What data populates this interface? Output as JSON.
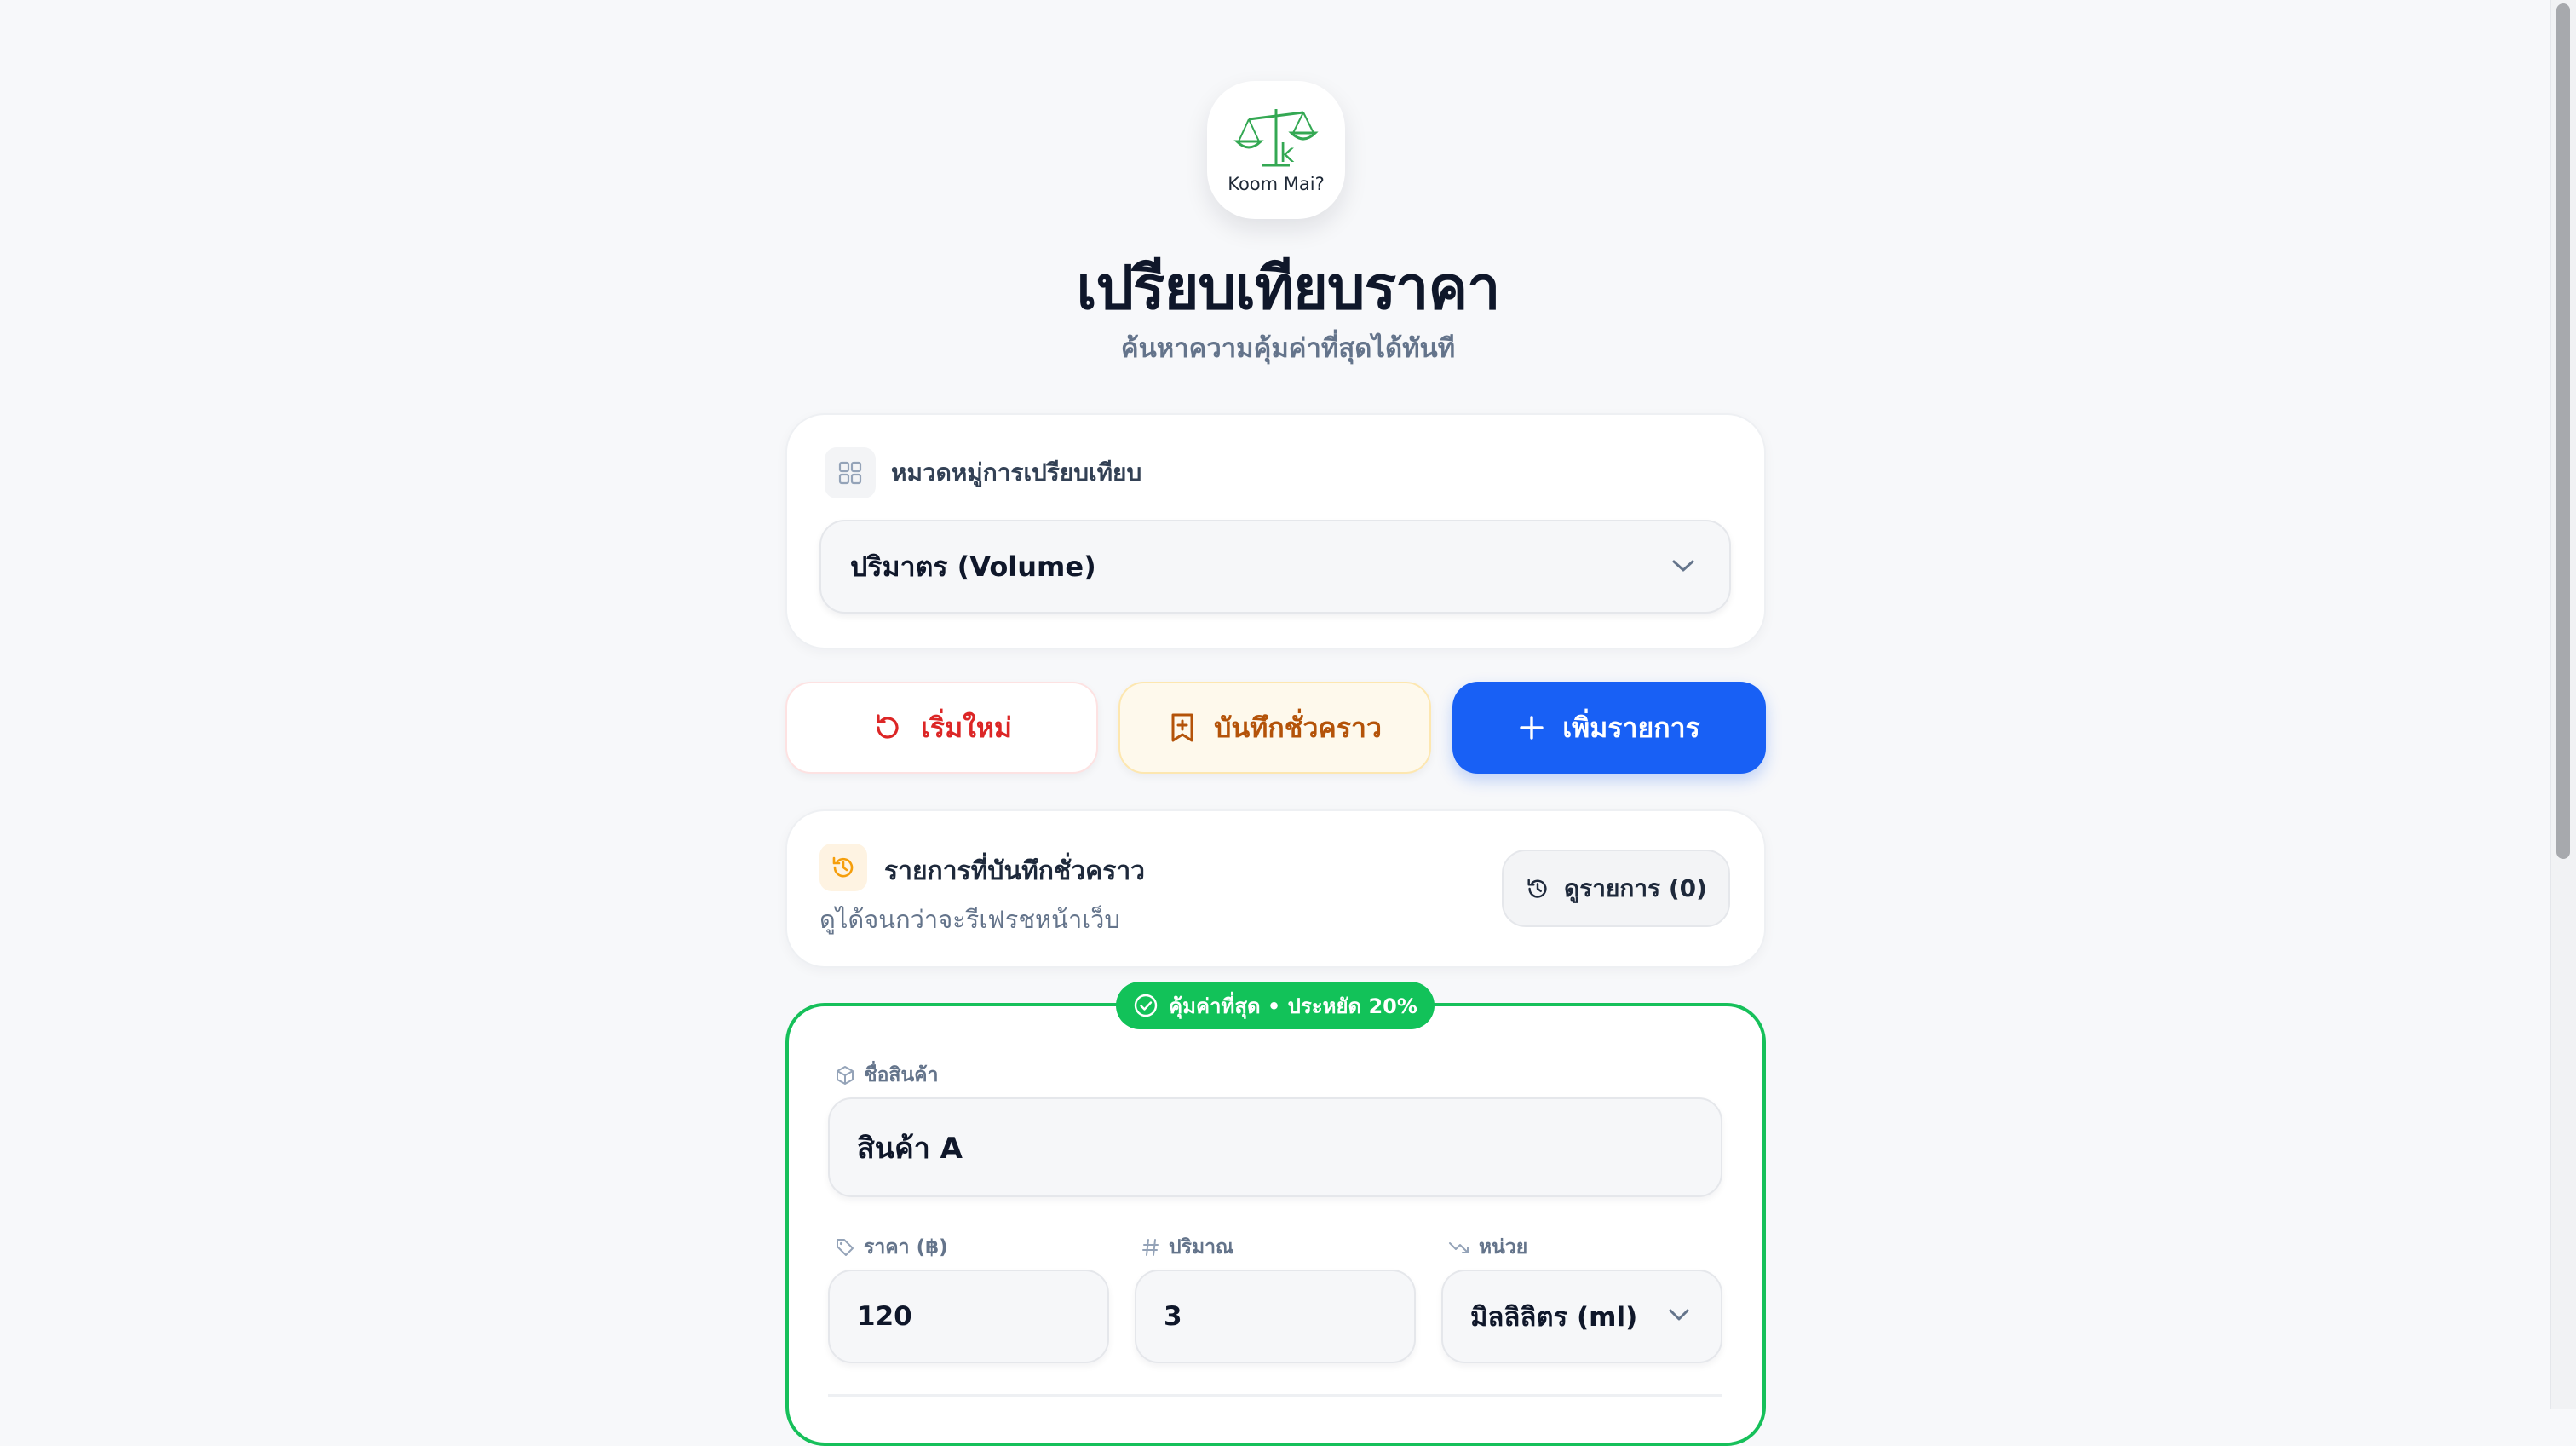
{
  "app": {
    "logo_text": "Koom Mai?",
    "title": "เปรียบเทียบราคา",
    "subtitle": "ค้นหาความคุ้มค่าที่สุดได้ทันที"
  },
  "category": {
    "label": "หมวดหมู่การเปรียบเทียบ",
    "selected": "ปริมาตร (Volume)"
  },
  "actions": {
    "reset_label": "เริ่มใหม่",
    "save_label": "บันทึกชั่วคราว",
    "add_label": "เพิ่มรายการ"
  },
  "saved": {
    "title": "รายการที่บันทึกชั่วคราว",
    "subtitle": "ดูได้จนกว่าจะรีเฟรชหน้าเว็บ",
    "view_label": "ดูรายการ (0)"
  },
  "items": [
    {
      "badge": "คุ้มค่าที่สุด • ประหยัด 20%",
      "name_label": "ชื่อสินค้า",
      "name": "สินค้า A",
      "price_label": "ราคา (฿)",
      "price": "120",
      "qty_label": "ปริมาณ",
      "qty": "3",
      "unit_label": "หน่วย",
      "unit": "มิลลิลิตร (ml)"
    }
  ],
  "colors": {
    "primary": "#1860f5",
    "best": "#12c259",
    "reset": "#dc2626",
    "save": "#b45309"
  }
}
